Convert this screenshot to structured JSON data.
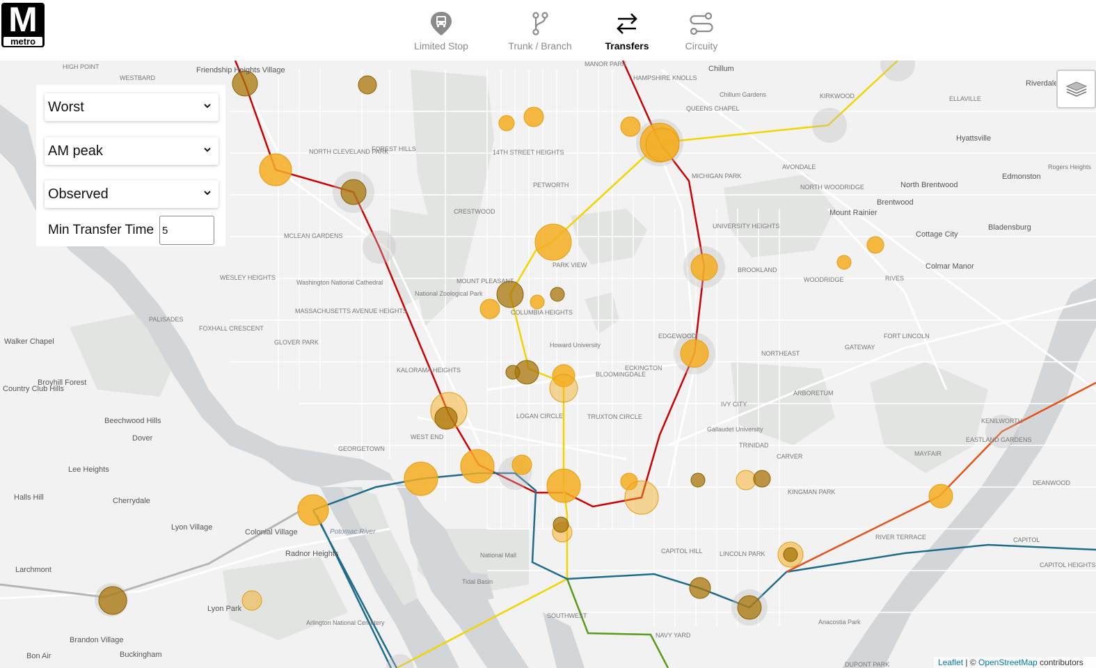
{
  "logo": {
    "letter": "M",
    "text": "metro"
  },
  "nav": {
    "items": [
      {
        "label": "Limited Stop",
        "icon": "bus-stop-icon",
        "active": false
      },
      {
        "label": "Trunk / Branch",
        "icon": "branch-icon",
        "active": false
      },
      {
        "label": "Transfers",
        "icon": "transfer-arrows-icon",
        "active": true
      },
      {
        "label": "Circuity",
        "icon": "route-circuity-icon",
        "active": false
      }
    ]
  },
  "controls": {
    "metric_select": "Worst",
    "period_select": "AM peak",
    "source_select": "Observed",
    "min_transfer_label": "Min Transfer Time",
    "min_transfer_value": "5"
  },
  "layers_control": {
    "icon": "layers-icon"
  },
  "attribution": {
    "leaflet": "Leaflet",
    "separator": " | © ",
    "osm": "OpenStreetMap",
    "suffix": " contributors"
  },
  "map_labels": [
    "HIGH POINT",
    "WESTBARD",
    "Friendship Heights Village",
    "Walker Chapel",
    "Country Club Hills",
    "Broyhill Forest",
    "Beechwood Hills",
    "Dover",
    "Lee Heights",
    "Cherrydale",
    "Halls Hill",
    "Lyon Village",
    "Colonial Village",
    "Radnor Heights",
    "Larchmont",
    "Brandon Village",
    "Buckingham",
    "Lyon Park",
    "Bon Air",
    "PALISADES",
    "FOXHALL CRESCENT",
    "GLOVER PARK",
    "KALORAMA HEIGHTS",
    "GEORGETOWN",
    "WEST END",
    "MOUNT PLEASANT",
    "COLUMBIA HEIGHTS",
    "PETWORTH",
    "PARK VIEW",
    "LOGAN CIRCLE",
    "TRUXTON CIRCLE",
    "ECKINGTON",
    "BLOOMINGDALE",
    "EDGEWOOD",
    "BROOKLAND",
    "WOODRIDGE",
    "NORTHEAST",
    "ARBORETUM",
    "IVY CITY",
    "TRINIDAD",
    "CARVER",
    "KINGMAN PARK",
    "CAPITOL HILL",
    "LINCOLN PARK",
    "NAVY YARD",
    "SOUTHWEST",
    "DUPONT PARK",
    "RIVER TERRACE",
    "MAYFAIR",
    "EASTLAND GARDENS",
    "KENILWORTH",
    "DEANWOOD",
    "CAPITOL HEIGHTS",
    "Chillum",
    "Chillum Gardens",
    "QUEENS CHAPEL",
    "AVONDALE",
    "MICHIGAN PARK",
    "NORTH WOODRIDGE",
    "Mount Rainier",
    "Brentwood",
    "North Brentwood",
    "Cottage City",
    "Colmar Manor",
    "Bladensburg",
    "Hyattsville",
    "Riverdale Park",
    "Edmonston",
    "Rogers Heights",
    "FORT LINCOLN",
    "GATEWAY",
    "MCLEAN GARDENS",
    "WESLEY HEIGHTS",
    "MASSACHUSETTS AVENUE HEIGHTS",
    "NORTH CLEVELAND PARK",
    "FOREST HILLS",
    "CRESTWOOD",
    "14TH STREET HEIGHTS",
    "MANOR PARK",
    "HAMPSHIRE KNOLLS",
    "Potomac River",
    "Tidal Basin",
    "National Mall",
    "Washington National Cathedral",
    "National Zoological Park",
    "Howard University",
    "Gallaudet University",
    "Arlington National Cemetery",
    "Anacostia Park",
    "UNIVERSITY HEIGHTS",
    "RIVES",
    "KIRKWOOD",
    "ELLAVILLE",
    "CAPITOL"
  ]
}
